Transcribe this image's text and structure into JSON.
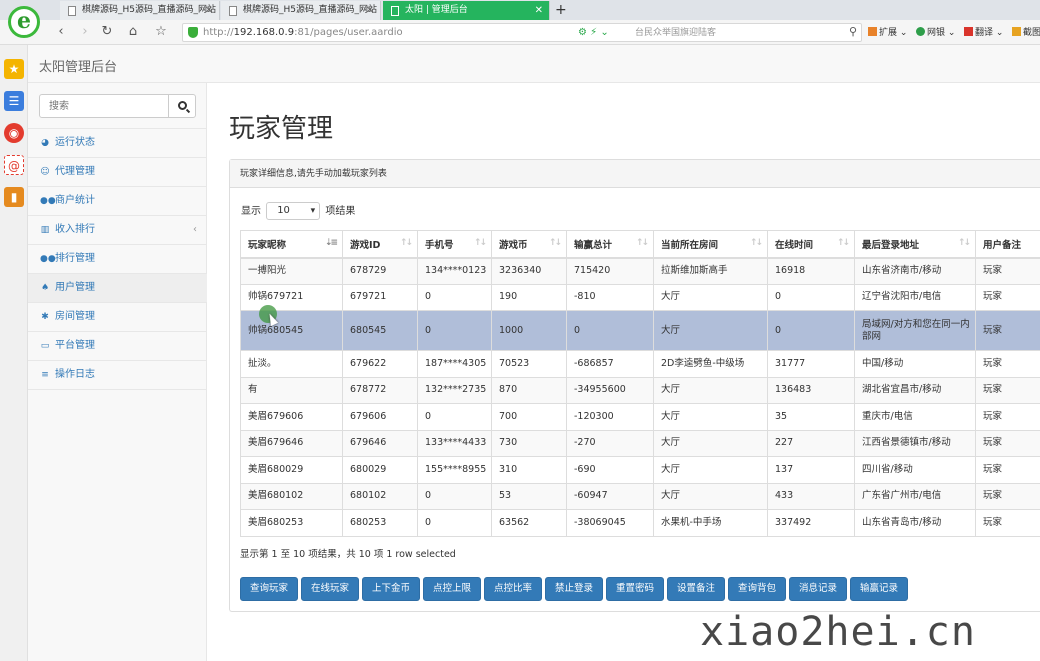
{
  "browser": {
    "tabs": [
      {
        "label": "棋牌源码_H5源码_直播源码_网站"
      },
      {
        "label": "棋牌源码_H5源码_直播源码_网站"
      },
      {
        "label": "太阳 | 管理后台"
      }
    ],
    "url_prefix": "http://",
    "url_host": "192.168.0.9",
    "url_path": ":81/pages/user.aardio",
    "address_hint": "台民众举国旗迎陆客",
    "toolbar_items": {
      "extensions": "扩展",
      "netbank": "网银",
      "translate": "翻译",
      "screenshot": "截图"
    }
  },
  "app": {
    "brand": "太阳管理后台",
    "search_placeholder": "搜索"
  },
  "sidebar": {
    "items": [
      {
        "label": "运行状态",
        "icon": "dashboard-icon"
      },
      {
        "label": "代理管理",
        "icon": "smile-icon"
      },
      {
        "label": "商户统计",
        "icon": "users-icon"
      },
      {
        "label": "收入排行",
        "icon": "bar-chart-icon"
      },
      {
        "label": "排行管理",
        "icon": "users-icon"
      },
      {
        "label": "用户管理",
        "icon": "bell-icon"
      },
      {
        "label": "房间管理",
        "icon": "gear-icon"
      },
      {
        "label": "平台管理",
        "icon": "card-icon"
      },
      {
        "label": "操作日志",
        "icon": "list-icon"
      }
    ]
  },
  "main": {
    "title": "玩家管理",
    "panel_heading": "玩家详细信息,请先手动加载玩家列表",
    "show_prefix": "显示",
    "page_size": "10",
    "show_suffix": "项结果",
    "columns": [
      "玩家昵称",
      "游戏ID",
      "手机号",
      "游戏币",
      "输赢总计",
      "当前所在房间",
      "在线时间",
      "最后登录地址",
      "用户备注"
    ],
    "rows": [
      [
        "一搏阳光",
        "678729",
        "134****0123",
        "3236340",
        "715420",
        "拉斯维加斯高手",
        "16918",
        "山东省济南市/移动",
        "玩家"
      ],
      [
        "帅锅679721",
        "679721",
        "0",
        "190",
        "-810",
        "大厅",
        "0",
        "辽宁省沈阳市/电信",
        "玩家"
      ],
      [
        "帅锅680545",
        "680545",
        "0",
        "1000",
        "0",
        "大厅",
        "0",
        "局域网/对方和您在同一内部网",
        "玩家"
      ],
      [
        "扯淡。",
        "679622",
        "187****4305",
        "70523",
        "-686857",
        "2D李逵劈鱼-中级场",
        "31777",
        "中国/移动",
        "玩家"
      ],
      [
        "有",
        "678772",
        "132****2735",
        "870",
        "-34955600",
        "大厅",
        "136483",
        "湖北省宜昌市/移动",
        "玩家"
      ],
      [
        "美眉679606",
        "679606",
        "0",
        "700",
        "-120300",
        "大厅",
        "35",
        "重庆市/电信",
        "玩家"
      ],
      [
        "美眉679646",
        "679646",
        "133****4433",
        "730",
        "-270",
        "大厅",
        "227",
        "江西省景德镇市/移动",
        "玩家"
      ],
      [
        "美眉680029",
        "680029",
        "155****8955",
        "310",
        "-690",
        "大厅",
        "137",
        "四川省/移动",
        "玩家"
      ],
      [
        "美眉680102",
        "680102",
        "0",
        "53",
        "-60947",
        "大厅",
        "433",
        "广东省广州市/电信",
        "玩家"
      ],
      [
        "美眉680253",
        "680253",
        "0",
        "63562",
        "-38069045",
        "水果机-中手场",
        "337492",
        "山东省青岛市/移动",
        "玩家"
      ]
    ],
    "info": "显示第 1 至 10 项结果，共 10 项    1 row selected",
    "buttons": [
      "查询玩家",
      "在线玩家",
      "上下金币",
      "点控上限",
      "点控比率",
      "禁止登录",
      "重置密码",
      "设置备注",
      "查询背包",
      "消息记录",
      "输赢记录"
    ]
  },
  "watermark": "xiao2hei.cn",
  "colors": {
    "primary": "#337ab7",
    "active_tab": "#25b45e",
    "selected_row": "#b0bed9"
  }
}
